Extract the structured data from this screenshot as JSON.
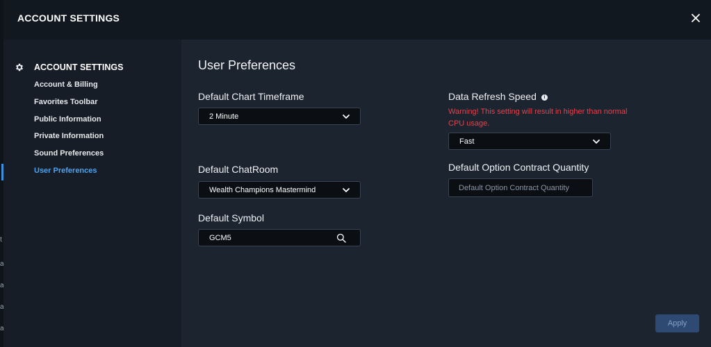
{
  "background": {
    "fragments": [
      "t",
      "a",
      "a",
      "a",
      "a"
    ]
  },
  "header": {
    "title": "ACCOUNT SETTINGS",
    "close_icon": "close-icon"
  },
  "sidebar": {
    "heading": "ACCOUNT SETTINGS",
    "heading_icon": "gear-icon",
    "items": [
      {
        "label": "Account & Billing",
        "active": false
      },
      {
        "label": "Favorites Toolbar",
        "active": false
      },
      {
        "label": "Public Information",
        "active": false
      },
      {
        "label": "Private Information",
        "active": false
      },
      {
        "label": "Sound Preferences",
        "active": false
      },
      {
        "label": "User Preferences",
        "active": true
      }
    ]
  },
  "main": {
    "title": "User Preferences",
    "chart_timeframe": {
      "label": "Default Chart Timeframe",
      "value": "2 Minute"
    },
    "chatroom": {
      "label": "Default ChatRoom",
      "value": "Wealth Champions Mastermind"
    },
    "symbol": {
      "label": "Default Symbol",
      "value": "GCM5",
      "icon": "search-icon"
    },
    "refresh_speed": {
      "label": "Data Refresh Speed",
      "info_icon": "info-icon",
      "warning": "Warning! This setting will result in higher than normal CPU usage.",
      "value": "Fast"
    },
    "option_quantity": {
      "label": "Default Option Contract Quantity",
      "placeholder": "Default Option Contract Quantity",
      "value": ""
    },
    "apply_label": "Apply"
  },
  "colors": {
    "accent": "#4da3f0",
    "warning": "#e2434b",
    "apply_bg": "#2e4a73"
  }
}
